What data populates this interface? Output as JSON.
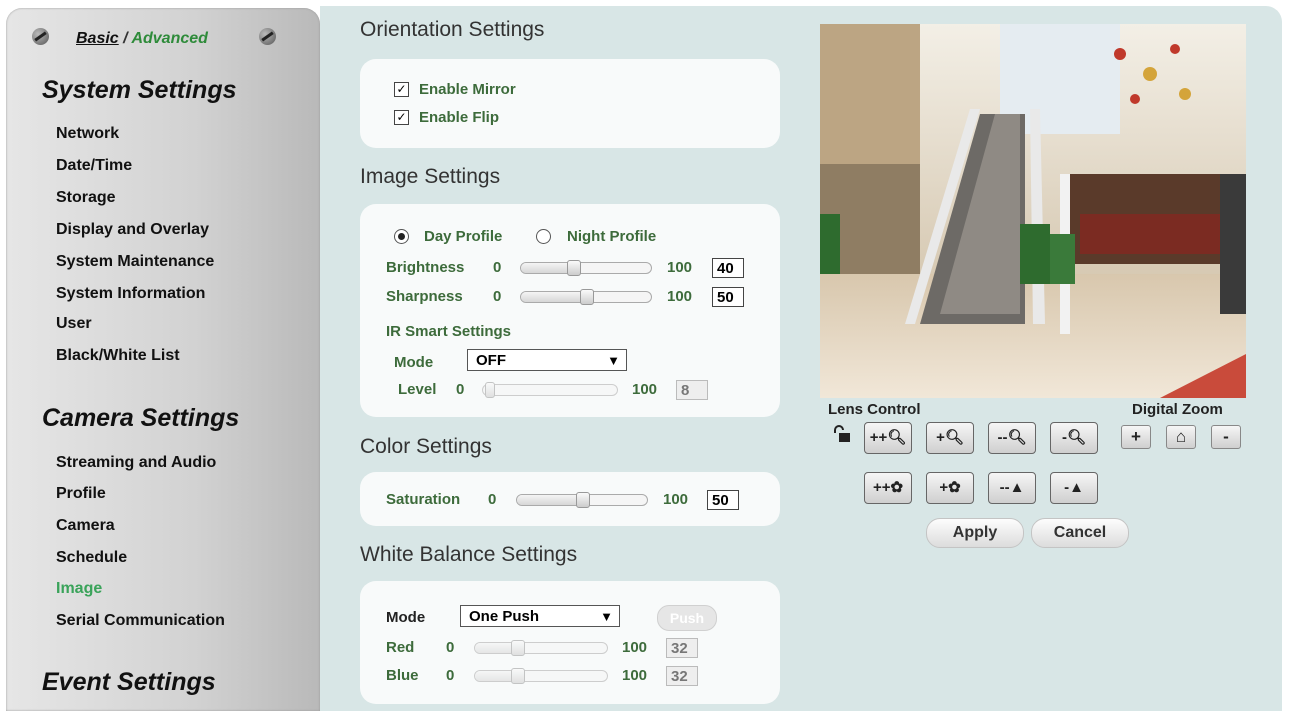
{
  "sidebar": {
    "mode_basic": "Basic",
    "mode_sep": " / ",
    "mode_advanced": "Advanced",
    "system_title": "System Settings",
    "system_items": [
      "Network",
      "Date/Time",
      "Storage",
      "Display and Overlay",
      "System Maintenance",
      "System Information",
      "User",
      "Black/White List"
    ],
    "camera_title": "Camera Settings",
    "camera_items": [
      "Streaming and Audio",
      "Profile",
      "Camera",
      "Schedule",
      "Image",
      "Serial Communication"
    ],
    "active_item": "Image",
    "event_title": "Event Settings"
  },
  "orientation": {
    "title": "Orientation Settings",
    "mirror_label": "Enable Mirror",
    "mirror_checked": true,
    "flip_label": "Enable Flip",
    "flip_checked": true
  },
  "image": {
    "title": "Image Settings",
    "day_profile": "Day Profile",
    "night_profile": "Night Profile",
    "selected_profile": "Day Profile",
    "brightness_label": "Brightness",
    "brightness_min": "0",
    "brightness_max": "100",
    "brightness_value": "40",
    "sharpness_label": "Sharpness",
    "sharpness_min": "0",
    "sharpness_max": "100",
    "sharpness_value": "50",
    "ir_title": "IR Smart Settings",
    "ir_mode_label": "Mode",
    "ir_mode_value": "OFF",
    "ir_level_label": "Level",
    "ir_level_min": "0",
    "ir_level_max": "100",
    "ir_level_value": "8"
  },
  "color": {
    "title": "Color Settings",
    "saturation_label": "Saturation",
    "saturation_min": "0",
    "saturation_max": "100",
    "saturation_value": "50"
  },
  "white_balance": {
    "title": "White Balance Settings",
    "mode_label": "Mode",
    "mode_value": "One Push",
    "push_label": "Push",
    "red_label": "Red",
    "red_min": "0",
    "red_max": "100",
    "red_value": "32",
    "blue_label": "Blue",
    "blue_min": "0",
    "blue_max": "100",
    "blue_value": "32"
  },
  "camera": {
    "lens_control_label": "Lens Control",
    "digital_zoom_label": "Digital Zoom",
    "zoom_in_label": "+",
    "zoom_out_label": "-",
    "apply_label": "Apply",
    "cancel_label": "Cancel"
  },
  "colors": {
    "accent_green": "#3aa35a",
    "label_green": "#3d6b3b",
    "panel_bg": "#d8e6e6"
  }
}
